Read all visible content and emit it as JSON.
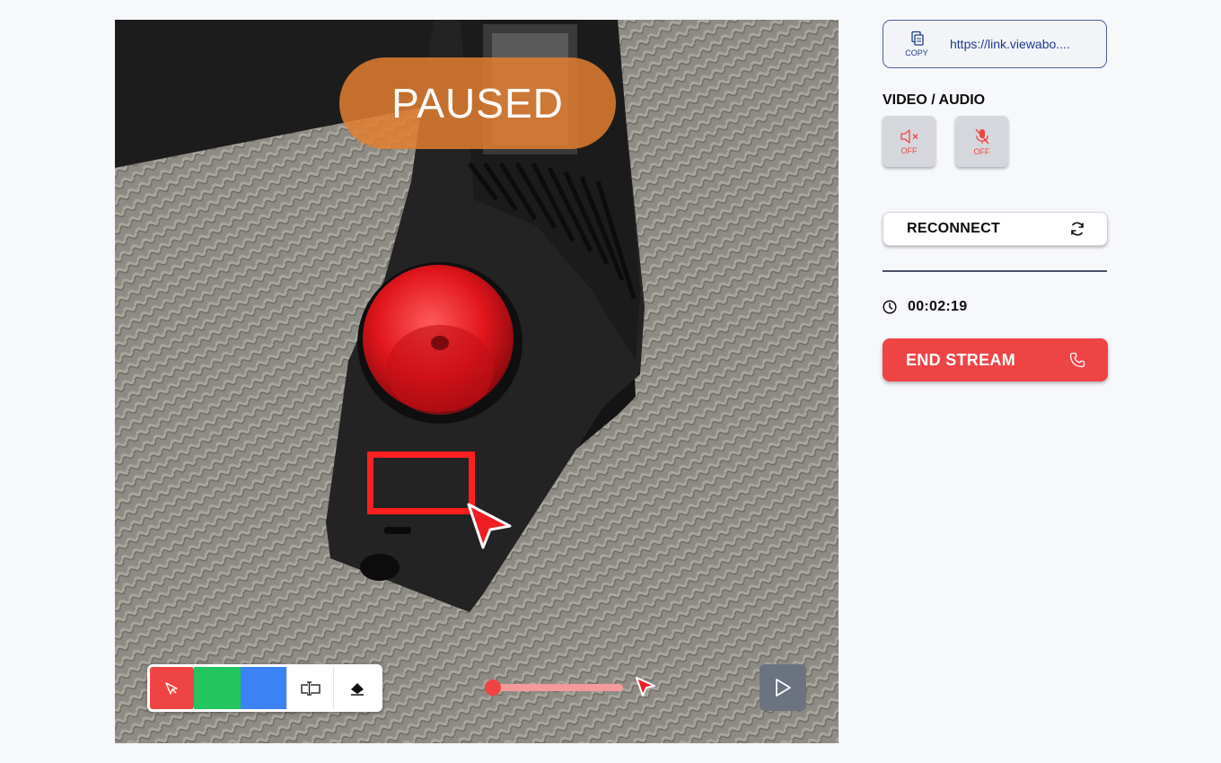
{
  "video": {
    "status_overlay": "PAUSED",
    "toolbar": {
      "tools": [
        {
          "name": "pointer-tool",
          "icon": "cursor-arrow-icon",
          "color": "#ef4444"
        },
        {
          "name": "green-color",
          "color": "#22c55e"
        },
        {
          "name": "blue-color",
          "color": "#3b82f6"
        },
        {
          "name": "text-tool",
          "icon": "text-cursor-icon"
        },
        {
          "name": "eraser-tool",
          "icon": "eraser-icon"
        }
      ]
    },
    "play_button_icon": "play-icon"
  },
  "sidebar": {
    "copy": {
      "label": "COPY",
      "url": "https://link.viewabo...."
    },
    "video_audio": {
      "title": "VIDEO / AUDIO",
      "speaker": {
        "state": "OFF",
        "icon": "speaker-muted-icon"
      },
      "mic": {
        "state": "OFF",
        "icon": "mic-off-icon"
      }
    },
    "reconnect": {
      "label": "RECONNECT",
      "icon": "refresh-icon"
    },
    "timer": {
      "icon": "clock-icon",
      "value": "00:02:19"
    },
    "end_stream": {
      "label": "END STREAM",
      "icon": "phone-icon",
      "color": "#ef4444"
    }
  }
}
